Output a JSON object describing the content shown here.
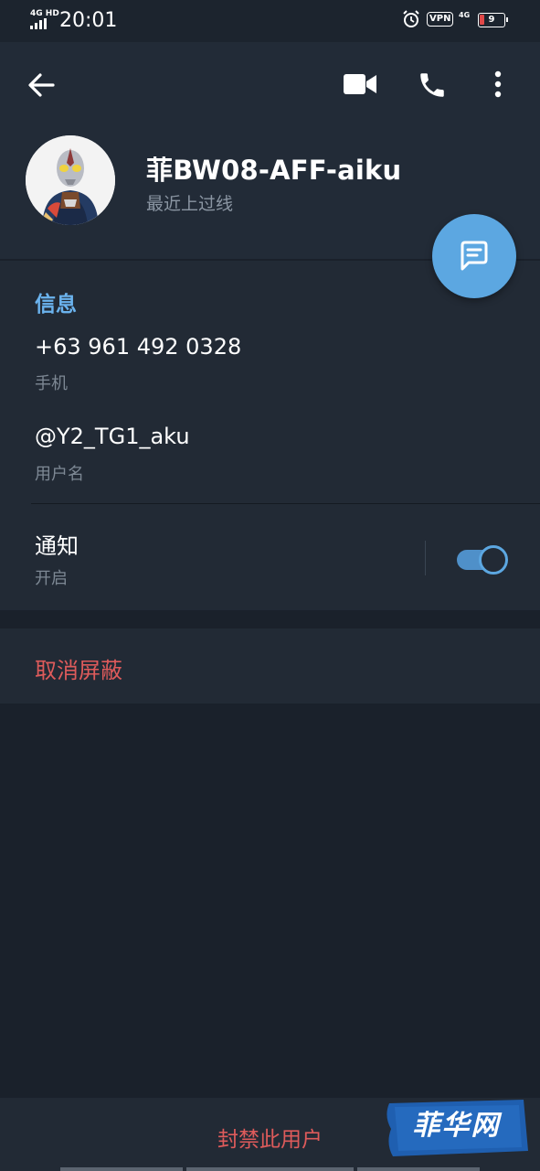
{
  "status_bar": {
    "network": "4G HD",
    "time": "20:01",
    "vpn": "VPN",
    "network2": "4G",
    "battery": "9"
  },
  "header": {
    "name": "菲BW08-AFF-aiku",
    "last_seen": "最近上过线"
  },
  "info": {
    "section_title": "信息",
    "phone": "+63 961 492 0328",
    "phone_label": "手机",
    "username": "@Y2_TG1_aku",
    "username_label": "用户名",
    "notifications": "通知",
    "notifications_status": "开启",
    "notifications_on": true
  },
  "actions": {
    "unblock": "取消屏蔽",
    "ban_user": "封禁此用户"
  },
  "watermark": {
    "text": "菲华网"
  },
  "colors": {
    "accent": "#5ca7e1",
    "danger": "#de5b5b",
    "background": "#1a212b",
    "card": "#222a35"
  }
}
